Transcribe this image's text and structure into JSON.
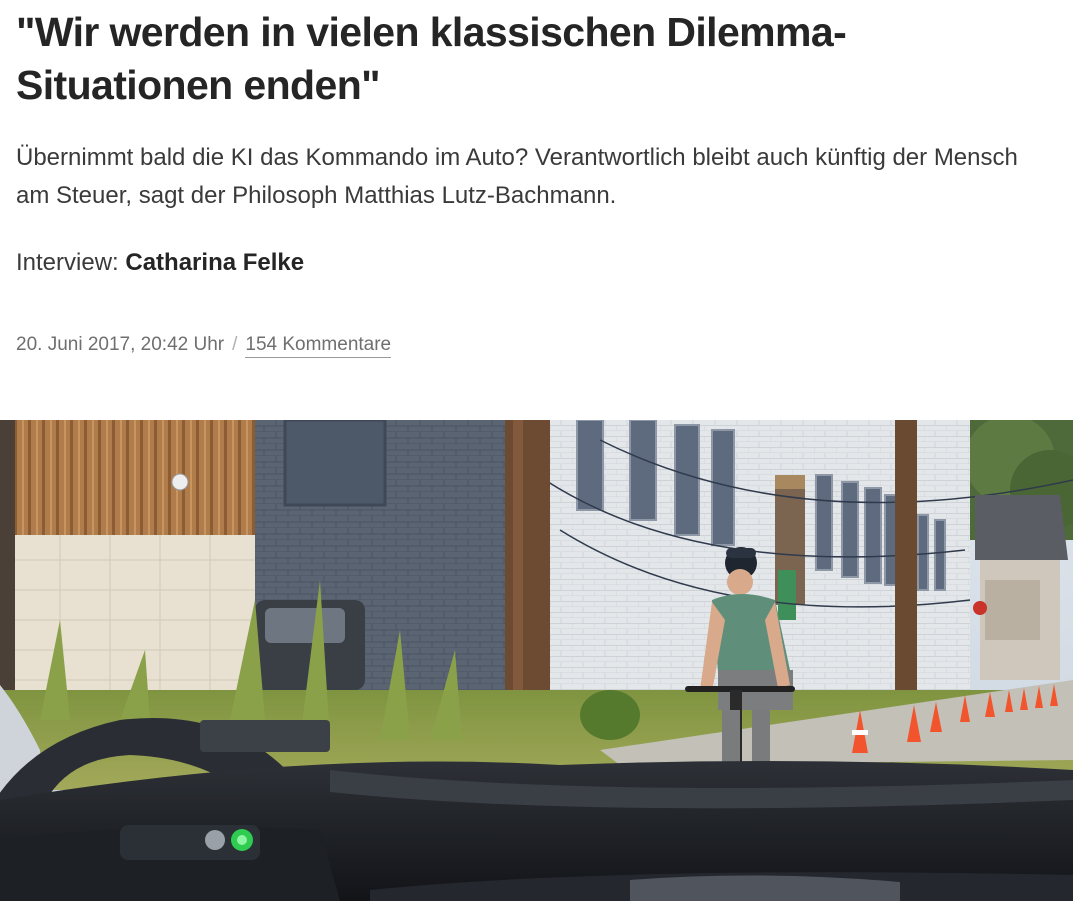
{
  "article": {
    "headline": "\"Wir werden in vielen klassischen Dilemma-Situationen enden\"",
    "summary": "Übernimmt bald die KI das Kommando im Auto? Verantwortlich bleibt auch künftig der Mensch am Steuer, sagt der Philosoph Matthias Lutz-Bachmann.",
    "byline_prefix": "Interview: ",
    "author": "Catharina Felke",
    "date": "20. Juni 2017, 20:42 Uhr",
    "separator": "/",
    "comments": "154 Kommentare"
  },
  "hero_image": {
    "depicts": "cyclist-street-through-car-windshield"
  },
  "colors": {
    "text": "#252525",
    "meta": "#6f6f6f"
  }
}
